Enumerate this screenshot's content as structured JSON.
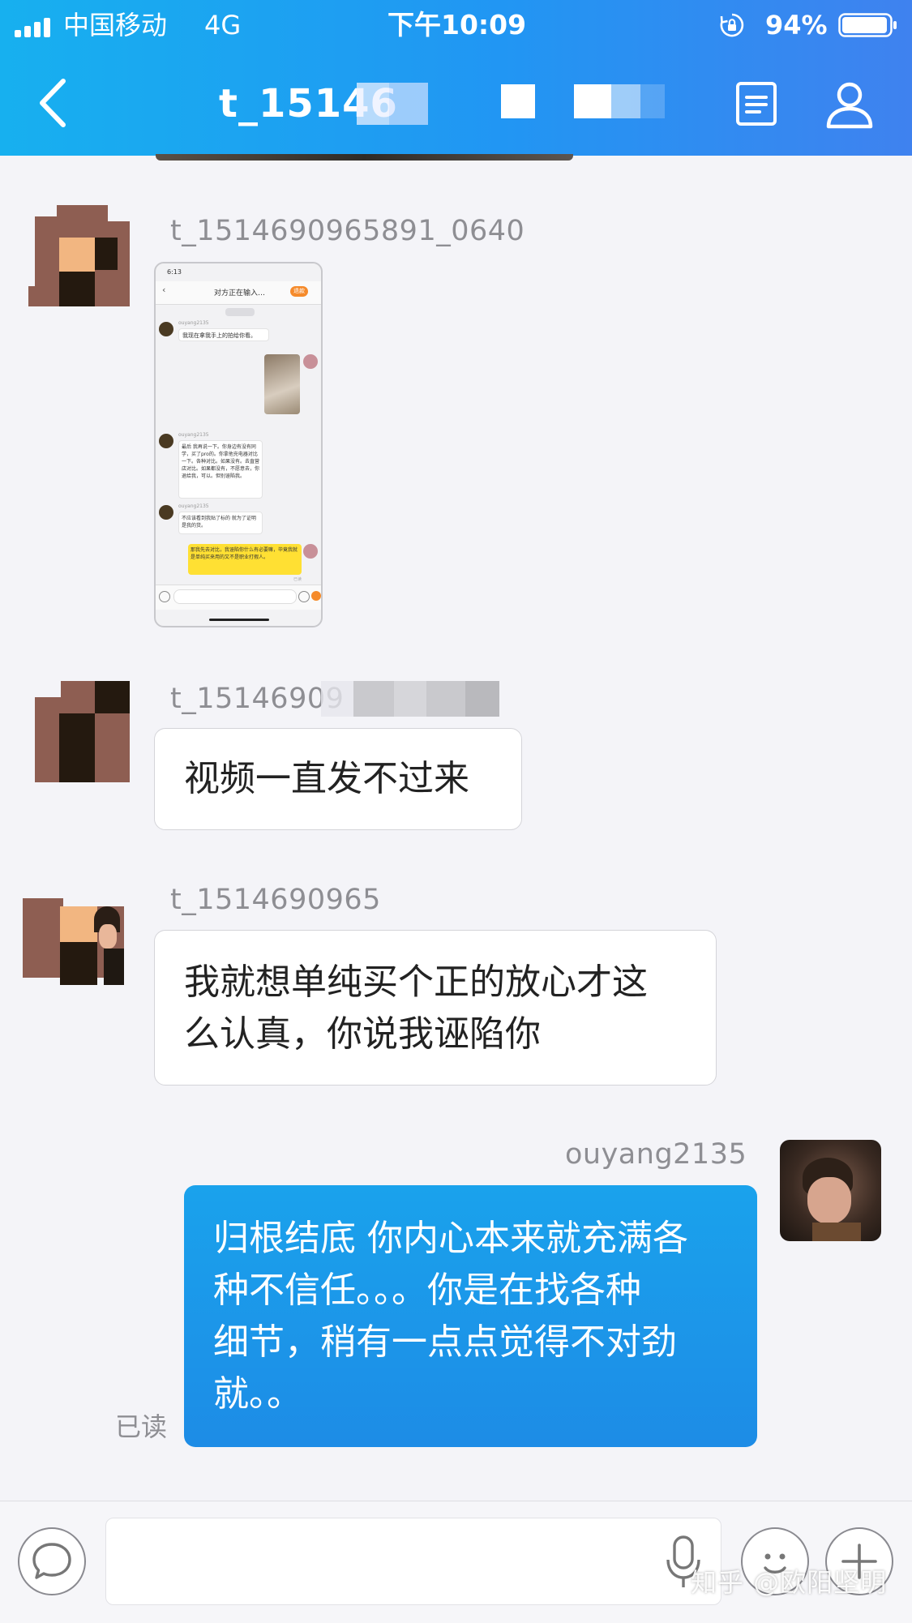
{
  "status_bar": {
    "carrier": "中国移动",
    "network": "4G",
    "time": "下午10:09",
    "battery": "94%"
  },
  "header": {
    "title": "t_15146",
    "back_icon": "chevron-left-icon",
    "doc_icon": "document-icon",
    "profile_icon": "user-icon"
  },
  "messages": [
    {
      "sender": "t_1514690965891_0640",
      "type": "image",
      "image_content": {
        "time": "6:13",
        "title": "对方正在输入…",
        "badge": "退款",
        "sender_1": "ouyang2135",
        "msg_1": "我现在拿我手上的拍给你看。",
        "sender_2": "ouyang2135",
        "msg_2": "最后 我再说一下。你身边有没有同学，买了pro的。你拿他充电器对比一下。各种对比。如果没有。去直营店对比。如果都没有，不愿意去，你退给我，可以。但别诬陷我。",
        "sender_3": "ouyang2135",
        "msg_3": "不应该看到我贴了标的 就为了证明是我的货。",
        "msg_4": "那我先去对比，我诬陷你什么有必要嘛，毕竟我就是单纯买来用的又不是职业打假人。",
        "read": "已读"
      }
    },
    {
      "sender": "t_15146909",
      "type": "text",
      "text": "视频一直发不过来"
    },
    {
      "sender": "t_1514690965",
      "type": "text",
      "text_lines": [
        "我就想单纯买个正的放心才这",
        "么认真，你说我诬陷你"
      ]
    },
    {
      "sender": "ouyang2135",
      "type": "text",
      "outgoing": true,
      "text_lines": [
        "归根结底 你内心本来就充满各",
        "种不信任。。。你是在找各种",
        "细节，稍有一点点觉得不对劲",
        "就。。"
      ],
      "status": "已读"
    }
  ],
  "input_bar": {
    "chat_icon": "speech-bubble-icon",
    "mic_icon": "microphone-icon",
    "emoji_icon": "emoji-icon",
    "plus_icon": "plus-icon"
  },
  "watermark": "知乎 @欧阳坚明",
  "colors": {
    "header_start": "#17b0ef",
    "header_end": "#3f82ef",
    "outgoing_bubble": "#1d8ce6",
    "background": "#f4f4f8"
  }
}
